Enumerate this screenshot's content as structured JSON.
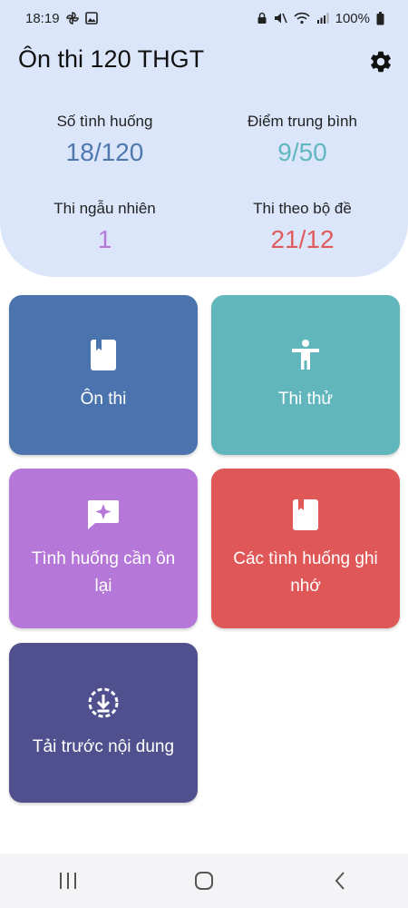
{
  "status_bar": {
    "time": "18:19",
    "battery": "100%",
    "left_icons": [
      "pinwheel-icon",
      "image-icon"
    ],
    "right_icons": [
      "lock-icon",
      "mute-icon",
      "wifi-icon",
      "signal-icon",
      "battery-icon"
    ]
  },
  "header": {
    "title": "Ôn thi 120 THGT",
    "settings_icon": "gear-icon"
  },
  "stats": [
    {
      "label": "Số tình huống",
      "value": "18/120",
      "color": "#4f79ad"
    },
    {
      "label": "Điểm trung bình",
      "value": "9/50",
      "color": "#62b8c0"
    },
    {
      "label": "Thi ngẫu nhiên",
      "value": "1",
      "color": "#b67bd6"
    },
    {
      "label": "Thi theo bộ đề",
      "value": "21/12",
      "color": "#e05c5c"
    }
  ],
  "tiles": [
    {
      "label": "Ôn thi",
      "icon": "book-icon",
      "color": "#4b74ae"
    },
    {
      "label": "Thi thử",
      "icon": "person-icon",
      "color": "#61b6bc"
    },
    {
      "label": "Tình huống cần ôn lại",
      "icon": "sparkle-chat-icon",
      "color": "#b678d8"
    },
    {
      "label": "Các tình huống ghi nhớ",
      "icon": "bookmark-book-icon",
      "color": "#e05757"
    },
    {
      "label": "Tải trước nội dung",
      "icon": "download-circle-icon",
      "color": "#51508e"
    }
  ],
  "nav": [
    "recent-apps-icon",
    "home-icon",
    "back-icon"
  ]
}
